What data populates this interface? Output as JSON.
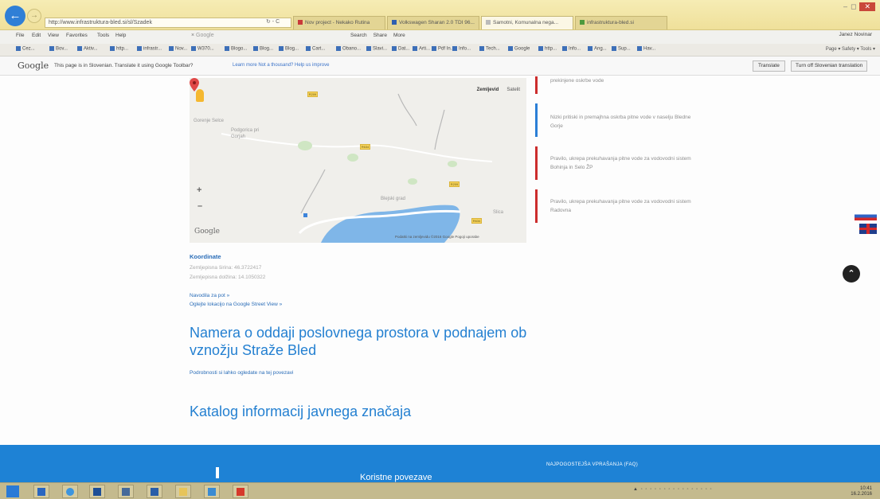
{
  "browser": {
    "address": "http://www.infrastruktura-bled.si/sl/Szadek",
    "address_tools": "↻ - C",
    "tabs": [
      {
        "label": "Nov project - Nekako Rutina",
        "color": "#c93a3a"
      },
      {
        "label": "Volkswagen Sharan 2.0 TDI 96...",
        "color": "#2f5fb0"
      },
      {
        "label": "Samotni, Komunalna nega...",
        "color": "#e0e0e0",
        "active": true
      },
      {
        "label": "infrastruktura-bled.si",
        "color": "#4d9a3d"
      }
    ],
    "window_controls": {
      "minimize": "–",
      "maximize": "◻",
      "close": "✕"
    },
    "menu": [
      "File",
      "Edit",
      "View",
      "Favorites",
      "Tools",
      "Help"
    ],
    "search_engine": "Google",
    "menu_right": [
      "Search",
      "Share",
      "More"
    ],
    "menu_user": "Janez Novinar",
    "favorites": [
      "Cez...",
      "Bov...",
      "Aktiv...",
      "http...",
      "infrastr...",
      "Nov...",
      "W370...",
      "Blogo...",
      "Blog...",
      "Blog...",
      "Cart...",
      "Obano...",
      "Slavi...",
      "Dat...",
      "Arti...",
      "Pdf In...",
      "Info...",
      "Tech...",
      "Google",
      "http...",
      "Info...",
      "Ang...",
      "Sup...",
      "Hav..."
    ],
    "fav_tools": "Page ▾  Safety ▾  Tools ▾"
  },
  "translate_bar": {
    "logo": "Google",
    "message": "This page is in Slovenian. Translate it using Google Toolbar?",
    "links": "Learn more  Not a thousand?  Help us improve",
    "translate_button": "Translate",
    "turn_off_button": "Turn off Slovenian translation"
  },
  "map": {
    "type_map": "Zemljevid",
    "type_satellite": "Satelit",
    "labels": [
      "Gorenje Selce",
      "Podgorica pri Gorjah",
      "Blejski grad",
      "Slica"
    ],
    "zoom_in": "+",
    "zoom_out": "–",
    "logo": "Google",
    "footer": "Podatki na zemljevidu ©2016 Google   Pogoji uporabe",
    "road_badges": [
      "R209",
      "R634",
      "R209",
      "R634"
    ]
  },
  "notices": [
    {
      "text": "prekinjene oskrbe vode",
      "accent": "red"
    },
    {
      "text": "Nizki pritiski in premajhna oskrba pitne vode v naselju Bledne Gorje",
      "accent": "blue"
    },
    {
      "text": "Pravilo, ukrepa prekuhavanja pitne vode za vodovodni sistem Bohinja in Selo ŽP",
      "accent": "red"
    },
    {
      "text": "Pravilo, ukrepa prekuhavanja pitne vode za vodovodni sistem Radovna",
      "accent": "red"
    }
  ],
  "coords": {
    "title": "Koordinate",
    "lat": "Zemljepisna širina: 46.3722417",
    "lon": "Zemljepisna dolžina: 14.1050322"
  },
  "links": {
    "navigation": "Navodila za pot »",
    "streetview": "Oglejte lokacijo na Google Street View »"
  },
  "notice_title": "Namera o oddaji poslovnega prostora v podnajem ob vznožju Straže Bled",
  "notice_sub": "Podrobnosti si lahko ogledate na tej povezavi",
  "catalog_title": "Katalog informacij javnega značaja",
  "footer": {
    "left": "Koristne povezave",
    "right": "NAJPOGOSTEJŠA VPRAŠANJA (FAQ)"
  },
  "scroll_top": "⌃",
  "taskbar": {
    "tray": "▲ ◦ ◦ ◦ ◦ ◦ ◦ ◦ ◦ ◦ ◦ ◦ ◦ ◦ ◦ ◦ ◦",
    "time": "10:41",
    "date": "16.2.2016"
  },
  "colors": {
    "accent_blue": "#2480d1",
    "footer_blue": "#1e82d5",
    "notice_red": "#cc2d2d",
    "titlebar_yellow": "#f6ecb4"
  }
}
